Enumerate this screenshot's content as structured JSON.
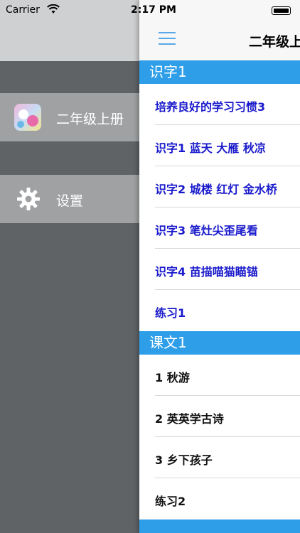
{
  "status_bar": {
    "carrier": "Carrier",
    "time": "2:17 PM"
  },
  "side_menu": {
    "items": [
      {
        "label": "二年级上册",
        "icon": "app-thumbnail-icon"
      },
      {
        "label": "设置",
        "icon": "gear-icon"
      }
    ]
  },
  "navbar": {
    "title": "二年级上",
    "menu_icon": "hamburger-icon"
  },
  "sections": [
    {
      "title": "识字1",
      "rows": [
        "培养良好的学习习惯3",
        "识字1 蓝天 大雁 秋凉",
        "识字2 城楼 红灯 金水桥",
        "识字3 笔灶尖歪尾看",
        "识字4 苗描喵猫瞄锚",
        "练习1"
      ]
    },
    {
      "title": "课文1",
      "rows": [
        "1 秋游",
        "2 英英学古诗",
        "3 乡下孩子",
        "练习2"
      ]
    }
  ],
  "colors": {
    "section_header": "#2e9ee9",
    "link_text": "#1a1acc",
    "sidebar_bg": "#5f6366",
    "sidebar_item": "#9fa1a3"
  }
}
